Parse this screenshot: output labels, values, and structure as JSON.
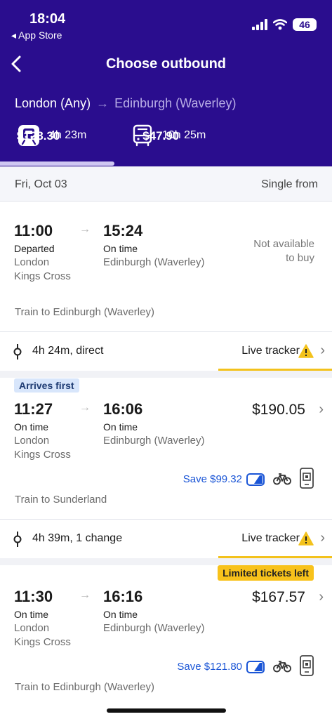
{
  "status": {
    "time": "18:04",
    "back_label": "◂ App Store",
    "battery": "46"
  },
  "nav": {
    "title": "Choose outbound"
  },
  "route": {
    "origin": "London (Any)",
    "destination": "Edinburgh (Waverley)"
  },
  "modes": [
    {
      "icon": "train-icon",
      "price": "$128.30",
      "duration": "4h 23m"
    },
    {
      "icon": "bus-icon",
      "price": "$47.90",
      "duration": "10h 25m"
    }
  ],
  "date_bar": {
    "date": "Fri, Oct 03",
    "label": "Single from"
  },
  "journeys": [
    {
      "depart_time": "11:00",
      "depart_status": "Departed",
      "depart_place_1": "London",
      "depart_place_2": "Kings Cross",
      "arrive_time": "15:24",
      "arrive_status": "On time",
      "arrive_place": "Edinburgh (Waverley)",
      "availability_1": "Not available",
      "availability_2": "to buy",
      "train_to": "Train to Edinburgh (Waverley)",
      "duration": "4h 24m, direct",
      "live_tracker": "Live tracker"
    },
    {
      "badge": "Arrives first",
      "depart_time": "11:27",
      "depart_status": "On time",
      "depart_place_1": "London",
      "depart_place_2": "Kings Cross",
      "arrive_time": "16:06",
      "arrive_status": "On time",
      "arrive_place": "Edinburgh (Waverley)",
      "price": "$190.05",
      "save": "Save $99.32",
      "train_to": "Train to Sunderland",
      "duration": "4h 39m, 1 change",
      "live_tracker": "Live tracker"
    },
    {
      "badge": "Limited tickets left",
      "depart_time": "11:30",
      "depart_status": "On time",
      "depart_place_1": "London",
      "depart_place_2": "Kings Cross",
      "arrive_time": "16:16",
      "arrive_status": "On time",
      "arrive_place": "Edinburgh (Waverley)",
      "price": "$167.57",
      "save": "Save $121.80",
      "train_to": "Train to Edinburgh (Waverley)"
    }
  ],
  "colors": {
    "header": "#2a0d8e",
    "accent_blue": "#1a55d6",
    "warning_yellow": "#f3c21c"
  }
}
